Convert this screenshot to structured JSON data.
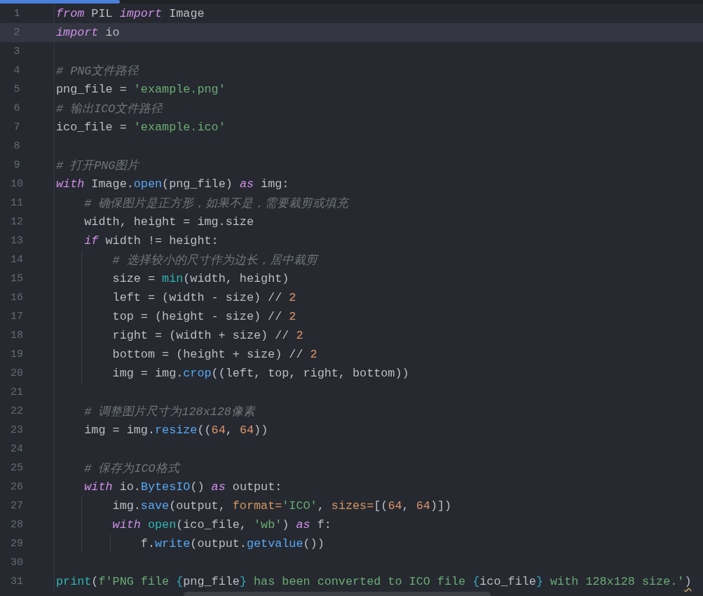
{
  "progress": {
    "level": 0.17
  },
  "lines": [
    {
      "number": "1",
      "current": false,
      "tokens": [
        {
          "kind": "kw",
          "text": "from"
        },
        {
          "kind": "plain",
          "text": " PIL "
        },
        {
          "kind": "kw",
          "text": "import"
        },
        {
          "kind": "plain",
          "text": " Image"
        }
      ]
    },
    {
      "number": "2",
      "current": true,
      "tokens": [
        {
          "kind": "kw",
          "text": "import"
        },
        {
          "kind": "plain",
          "text": " io"
        }
      ]
    },
    {
      "number": "3",
      "current": false
    },
    {
      "number": "4",
      "current": false,
      "tokens": [
        {
          "kind": "comment",
          "text": "# PNG文件路径"
        }
      ]
    },
    {
      "number": "5",
      "current": false,
      "tokens": [
        {
          "kind": "plain",
          "text": "png_file = "
        },
        {
          "kind": "str",
          "text": "'example.png'"
        }
      ]
    },
    {
      "number": "6",
      "current": false,
      "tokens": [
        {
          "kind": "comment",
          "text": "# 输出ICO文件路径"
        }
      ]
    },
    {
      "number": "7",
      "current": false,
      "tokens": [
        {
          "kind": "plain",
          "text": "ico_file = "
        },
        {
          "kind": "str",
          "text": "'example.ico'"
        }
      ]
    },
    {
      "number": "8",
      "current": false
    },
    {
      "number": "9",
      "current": false,
      "tokens": [
        {
          "kind": "comment",
          "text": "# 打开PNG图片"
        }
      ]
    },
    {
      "number": "10",
      "current": false,
      "tokens": [
        {
          "kind": "kw",
          "text": "with"
        },
        {
          "kind": "plain",
          "text": " Image."
        },
        {
          "kind": "fn",
          "text": "open"
        },
        {
          "kind": "plain",
          "text": "(png_file) "
        },
        {
          "kind": "kw",
          "text": "as"
        },
        {
          "kind": "plain",
          "text": " img:"
        }
      ]
    },
    {
      "number": "11",
      "current": false,
      "tokens": [
        {
          "kind": "comment",
          "text": "    # 确保图片是正方形，如果不是，需要裁剪或填充"
        }
      ]
    },
    {
      "number": "12",
      "current": false,
      "tokens": [
        {
          "kind": "plain",
          "text": "    width, height = img.size"
        }
      ]
    },
    {
      "number": "13",
      "current": false,
      "tokens": [
        {
          "kind": "kw",
          "text": "    if"
        },
        {
          "kind": "plain",
          "text": " width != height:"
        }
      ]
    },
    {
      "number": "14",
      "current": false,
      "tokens": [
        {
          "kind": "comment",
          "text": "        # 选择较小的尺寸作为边长，居中裁剪"
        }
      ]
    },
    {
      "number": "15",
      "current": false,
      "tokens": [
        {
          "kind": "plain",
          "text": "        size = "
        },
        {
          "kind": "builtin",
          "text": "min"
        },
        {
          "kind": "plain",
          "text": "(width, height)"
        }
      ]
    },
    {
      "number": "16",
      "current": false,
      "tokens": [
        {
          "kind": "plain",
          "text": "        left = (width - size) // "
        },
        {
          "kind": "num",
          "text": "2"
        }
      ]
    },
    {
      "number": "17",
      "current": false,
      "tokens": [
        {
          "kind": "plain",
          "text": "        top = (height - size) // "
        },
        {
          "kind": "num",
          "text": "2"
        }
      ]
    },
    {
      "number": "18",
      "current": false,
      "tokens": [
        {
          "kind": "plain",
          "text": "        right = (width + size) // "
        },
        {
          "kind": "num",
          "text": "2"
        }
      ]
    },
    {
      "number": "19",
      "current": false,
      "tokens": [
        {
          "kind": "plain",
          "text": "        bottom = (height + size) // "
        },
        {
          "kind": "num",
          "text": "2"
        }
      ]
    },
    {
      "number": "20",
      "current": false,
      "tokens": [
        {
          "kind": "plain",
          "text": "        img = img."
        },
        {
          "kind": "fn",
          "text": "crop"
        },
        {
          "kind": "plain",
          "text": "((left, top, right, bottom))"
        }
      ]
    },
    {
      "number": "21",
      "current": false
    },
    {
      "number": "22",
      "current": false,
      "tokens": [
        {
          "kind": "comment",
          "text": "    # 调整图片尺寸为128x128像素"
        }
      ]
    },
    {
      "number": "23",
      "current": false,
      "tokens": [
        {
          "kind": "plain",
          "text": "    img = img."
        },
        {
          "kind": "fn",
          "text": "resize"
        },
        {
          "kind": "plain",
          "text": "(("
        },
        {
          "kind": "num",
          "text": "64"
        },
        {
          "kind": "plain",
          "text": ", "
        },
        {
          "kind": "num",
          "text": "64"
        },
        {
          "kind": "plain",
          "text": "))"
        }
      ]
    },
    {
      "number": "24",
      "current": false
    },
    {
      "number": "25",
      "current": false,
      "tokens": [
        {
          "kind": "comment",
          "text": "    # 保存为ICO格式"
        }
      ]
    },
    {
      "number": "26",
      "current": false,
      "tokens": [
        {
          "kind": "kw",
          "text": "    with"
        },
        {
          "kind": "plain",
          "text": " io."
        },
        {
          "kind": "fn",
          "text": "BytesIO"
        },
        {
          "kind": "plain",
          "text": "() "
        },
        {
          "kind": "kw",
          "text": "as"
        },
        {
          "kind": "plain",
          "text": " output:"
        }
      ]
    },
    {
      "number": "27",
      "current": false,
      "tokens": [
        {
          "kind": "plain",
          "text": "        img."
        },
        {
          "kind": "fn",
          "text": "save"
        },
        {
          "kind": "plain",
          "text": "(output, "
        },
        {
          "kind": "param",
          "text": "format="
        },
        {
          "kind": "str",
          "text": "'ICO'"
        },
        {
          "kind": "plain",
          "text": ", "
        },
        {
          "kind": "param",
          "text": "sizes="
        },
        {
          "kind": "plain",
          "text": "[("
        },
        {
          "kind": "num",
          "text": "64"
        },
        {
          "kind": "plain",
          "text": ", "
        },
        {
          "kind": "num",
          "text": "64"
        },
        {
          "kind": "plain",
          "text": ")])"
        }
      ]
    },
    {
      "number": "28",
      "current": false,
      "tokens": [
        {
          "kind": "kw",
          "text": "        with "
        },
        {
          "kind": "builtin",
          "text": "open"
        },
        {
          "kind": "plain",
          "text": "(ico_file, "
        },
        {
          "kind": "str",
          "text": "'wb'"
        },
        {
          "kind": "plain",
          "text": ") "
        },
        {
          "kind": "kw",
          "text": "as"
        },
        {
          "kind": "plain",
          "text": " f:"
        }
      ]
    },
    {
      "number": "29",
      "current": false,
      "tokens": [
        {
          "kind": "plain",
          "text": "            f."
        },
        {
          "kind": "fn",
          "text": "write"
        },
        {
          "kind": "plain",
          "text": "(output."
        },
        {
          "kind": "fn",
          "text": "getvalue"
        },
        {
          "kind": "plain",
          "text": "())"
        }
      ]
    },
    {
      "number": "30",
      "current": false
    },
    {
      "number": "31",
      "current": false,
      "tokens": [
        {
          "kind": "builtin",
          "text": "print"
        },
        {
          "kind": "plain",
          "text": "("
        },
        {
          "kind": "str",
          "text": "f'PNG file "
        },
        {
          "kind": "brace",
          "text": "{"
        },
        {
          "kind": "plain",
          "text": "png_file"
        },
        {
          "kind": "brace",
          "text": "}"
        },
        {
          "kind": "str",
          "text": " has been converted to ICO file "
        },
        {
          "kind": "brace",
          "text": "{"
        },
        {
          "kind": "plain",
          "text": "ico_file"
        },
        {
          "kind": "brace",
          "text": "}"
        },
        {
          "kind": "str",
          "text": " with 128x128 size.'"
        },
        {
          "kind": "plain",
          "text": ")",
          "warn": true
        }
      ]
    }
  ]
}
